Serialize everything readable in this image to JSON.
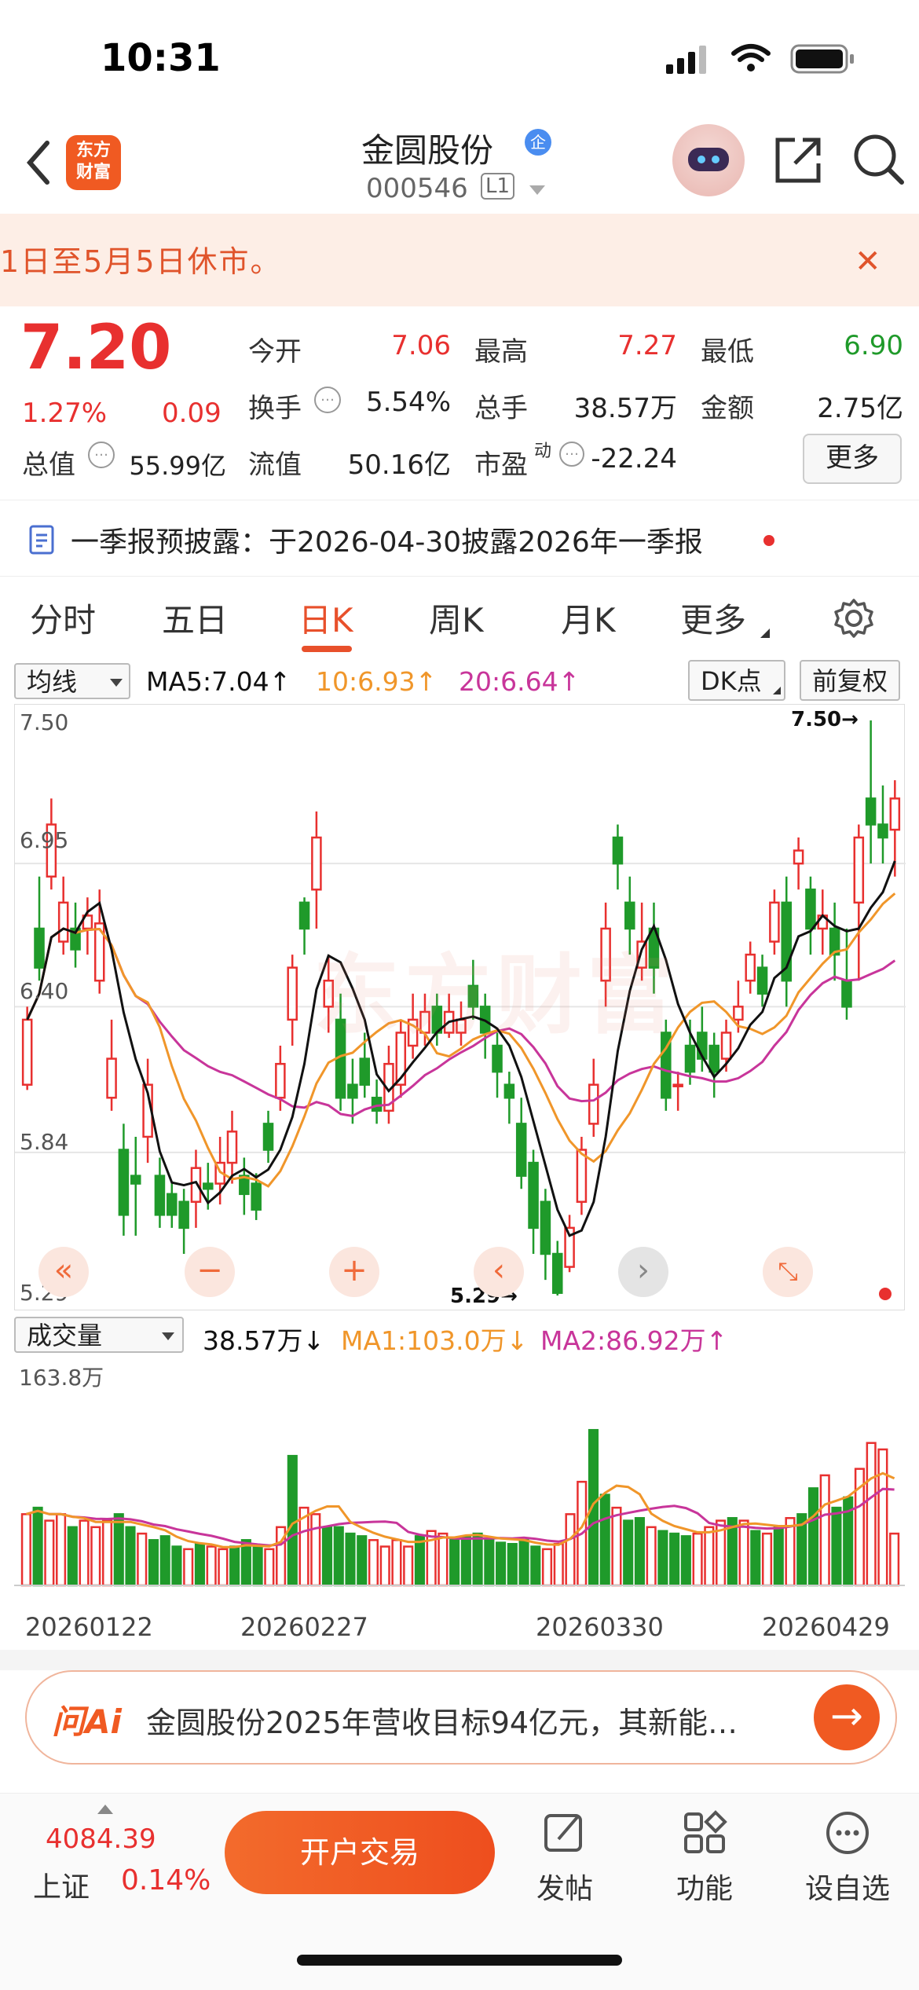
{
  "status_bar": {
    "time": "10:31"
  },
  "header": {
    "logo_text_top": "东方",
    "logo_text_bottom": "财富",
    "stock_name": "金圆股份",
    "badge": "企",
    "stock_code": "000546",
    "level": "L1"
  },
  "banner": {
    "text": "1日至5月5日休市。"
  },
  "quote": {
    "price": "7.20",
    "change_pct": "1.27%",
    "change": "0.09",
    "open_label": "今开",
    "open": "7.06",
    "high_label": "最高",
    "high": "7.27",
    "low_label": "最低",
    "low": "6.90",
    "turnover_label": "换手",
    "turnover": "5.54%",
    "volume_label": "总手",
    "volume": "38.57万",
    "amount_label": "金额",
    "amount": "2.75亿",
    "mktcap_label": "总值",
    "mktcap": "55.99亿",
    "float_label": "流值",
    "float_cap": "50.16亿",
    "pe_label": "市盈",
    "pe_sup": "动",
    "pe": "-22.24",
    "more_label": "更多"
  },
  "notice": {
    "text": "一季报预披露：于2026-04-30披露2026年一季报"
  },
  "tabs": {
    "t1": "分时",
    "t2": "五日",
    "t3": "日K",
    "t4": "周K",
    "t5": "月K",
    "t6": "更多"
  },
  "ma_bar": {
    "select": "均线",
    "ma5": "MA5:7.04↑",
    "ma10": "10:6.93↑",
    "ma20": "20:6.64↑",
    "dk": "DK点",
    "adjust": "前复权"
  },
  "chart_labels": {
    "y_top": "7.50",
    "y_2": "6.95",
    "y_3": "6.40",
    "y_4": "5.84",
    "y_bottom": "5.29",
    "max_marker": "7.50→",
    "min_marker": "5.29→",
    "watermark": "东方财富"
  },
  "volume_bar": {
    "select": "成交量",
    "vol": "38.57万↓",
    "ma1": "MA1:103.0万↓",
    "ma2": "MA2:86.92万↑",
    "y_max": "163.8万"
  },
  "dates": {
    "d1": "20260122",
    "d2": "20260227",
    "d3": "20260330",
    "d4": "20260429"
  },
  "ai": {
    "logo": "问Ai",
    "text": "金圆股份2025年营收目标94亿元，其新能…"
  },
  "bottom_bar": {
    "index_value": "4084.39",
    "index_name": "上证",
    "index_pct": "0.14%",
    "open_account": "开户交易",
    "post": "发帖",
    "functions": "功能",
    "watchlist": "设自选"
  },
  "colors": {
    "up": "#e8302f",
    "down": "#1f9a2a",
    "accent": "#f05a22",
    "ma5": "#111111",
    "ma10": "#f0962a",
    "ma20": "#c8359a"
  },
  "chart_data": {
    "type": "candlestick",
    "ylim": [
      5.29,
      7.5
    ],
    "candles": [
      [
        6.1,
        6.35,
        6.08,
        6.4
      ],
      [
        6.7,
        6.55,
        6.5,
        6.9
      ],
      [
        6.9,
        7.1,
        6.85,
        7.2
      ],
      [
        6.65,
        6.8,
        6.6,
        6.9
      ],
      [
        6.7,
        6.62,
        6.55,
        6.8
      ],
      [
        6.7,
        6.75,
        6.6,
        6.82
      ],
      [
        6.5,
        6.72,
        6.45,
        6.85
      ],
      [
        6.05,
        6.2,
        6.0,
        6.35
      ],
      [
        5.85,
        5.6,
        5.52,
        5.95
      ],
      [
        5.75,
        5.72,
        5.52,
        5.9
      ],
      [
        5.9,
        6.1,
        5.8,
        6.2
      ],
      [
        5.75,
        5.6,
        5.55,
        5.82
      ],
      [
        5.68,
        5.6,
        5.55,
        5.72
      ],
      [
        5.65,
        5.55,
        5.45,
        5.7
      ],
      [
        5.65,
        5.78,
        5.55,
        5.85
      ],
      [
        5.72,
        5.7,
        5.62,
        5.8
      ],
      [
        5.72,
        5.8,
        5.64,
        5.9
      ],
      [
        5.8,
        5.92,
        5.72,
        6.0
      ],
      [
        5.75,
        5.68,
        5.6,
        5.82
      ],
      [
        5.72,
        5.62,
        5.58,
        5.76
      ],
      [
        5.95,
        5.85,
        5.8,
        6.0
      ],
      [
        6.05,
        6.18,
        6.0,
        6.25
      ],
      [
        6.35,
        6.55,
        6.25,
        6.6
      ],
      [
        6.8,
        6.7,
        6.6,
        6.82
      ],
      [
        6.85,
        7.05,
        6.7,
        7.15
      ],
      [
        6.4,
        6.5,
        6.3,
        6.6
      ],
      [
        6.35,
        6.05,
        6.0,
        6.45
      ],
      [
        6.1,
        6.05,
        5.95,
        6.2
      ],
      [
        6.2,
        6.1,
        6.05,
        6.3
      ],
      [
        6.05,
        6.0,
        5.95,
        6.12
      ],
      [
        6.0,
        6.18,
        5.95,
        6.25
      ],
      [
        6.1,
        6.3,
        6.05,
        6.35
      ],
      [
        6.25,
        6.35,
        6.2,
        6.45
      ],
      [
        6.3,
        6.38,
        6.25,
        6.45
      ],
      [
        6.4,
        6.3,
        6.25,
        6.45
      ],
      [
        6.3,
        6.38,
        6.28,
        6.45
      ],
      [
        6.3,
        6.35,
        6.25,
        6.42
      ],
      [
        6.48,
        6.4,
        6.35,
        6.58
      ],
      [
        6.4,
        6.3,
        6.2,
        6.45
      ],
      [
        6.25,
        6.15,
        6.05,
        6.3
      ],
      [
        6.1,
        6.05,
        5.95,
        6.15
      ],
      [
        5.95,
        5.75,
        5.7,
        6.05
      ],
      [
        5.8,
        5.55,
        5.45,
        5.85
      ],
      [
        5.65,
        5.45,
        5.35,
        5.7
      ],
      [
        5.45,
        5.3,
        5.29,
        5.5
      ],
      [
        5.4,
        5.55,
        5.38,
        5.6
      ],
      [
        5.65,
        5.85,
        5.6,
        5.9
      ],
      [
        5.95,
        6.1,
        5.9,
        6.2
      ],
      [
        6.5,
        6.7,
        6.4,
        6.8
      ],
      [
        7.05,
        6.95,
        6.85,
        7.1
      ],
      [
        6.8,
        6.7,
        6.6,
        6.9
      ],
      [
        6.55,
        6.65,
        6.5,
        6.8
      ],
      [
        6.7,
        6.55,
        6.45,
        6.8
      ],
      [
        6.3,
        6.05,
        6.0,
        6.35
      ],
      [
        6.1,
        6.1,
        6.0,
        6.15
      ],
      [
        6.25,
        6.15,
        6.1,
        6.35
      ],
      [
        6.3,
        6.2,
        6.15,
        6.4
      ],
      [
        6.25,
        6.15,
        6.05,
        6.3
      ],
      [
        6.2,
        6.3,
        6.15,
        6.35
      ],
      [
        6.35,
        6.4,
        6.3,
        6.5
      ],
      [
        6.5,
        6.6,
        6.45,
        6.65
      ],
      [
        6.55,
        6.45,
        6.4,
        6.6
      ],
      [
        6.65,
        6.8,
        6.6,
        6.85
      ],
      [
        6.8,
        6.5,
        6.4,
        6.9
      ],
      [
        6.95,
        7.0,
        6.85,
        7.05
      ],
      [
        6.85,
        6.7,
        6.6,
        6.9
      ],
      [
        6.7,
        6.75,
        6.6,
        6.85
      ],
      [
        6.7,
        6.6,
        6.5,
        6.8
      ],
      [
        6.5,
        6.4,
        6.35,
        6.7
      ],
      [
        6.8,
        7.05,
        6.5,
        7.1
      ],
      [
        7.2,
        7.1,
        6.95,
        7.5
      ],
      [
        7.1,
        7.05,
        6.95,
        7.25
      ],
      [
        7.08,
        7.2,
        6.9,
        7.27
      ]
    ],
    "volumes": [
      55,
      60,
      50,
      55,
      45,
      50,
      45,
      50,
      55,
      45,
      40,
      35,
      38,
      30,
      28,
      32,
      30,
      28,
      30,
      35,
      30,
      28,
      45,
      100,
      60,
      55,
      45,
      45,
      40,
      38,
      35,
      30,
      35,
      30,
      38,
      42,
      40,
      35,
      38,
      40,
      35,
      33,
      32,
      35,
      30,
      28,
      32,
      55,
      80,
      120,
      70,
      60,
      50,
      52,
      45,
      42,
      40,
      38,
      40,
      45,
      50,
      52,
      50,
      42,
      40,
      45,
      52,
      55,
      75,
      85,
      60,
      68,
      90,
      110,
      105,
      40
    ]
  }
}
